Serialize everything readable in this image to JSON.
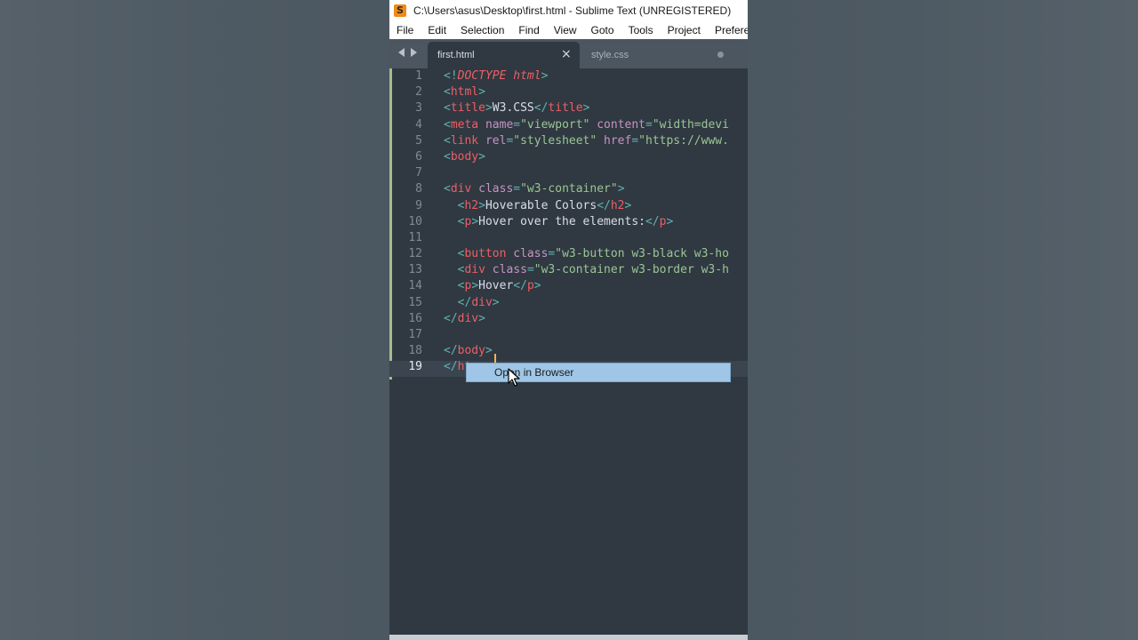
{
  "window": {
    "title": "C:\\Users\\asus\\Desktop\\first.html - Sublime Text (UNREGISTERED)",
    "app_icon_letter": "S"
  },
  "menu": [
    "File",
    "Edit",
    "Selection",
    "Find",
    "View",
    "Goto",
    "Tools",
    "Project",
    "Preferences"
  ],
  "tabs": [
    {
      "label": "first.html",
      "active": true,
      "close": "×"
    },
    {
      "label": "style.css",
      "active": false
    }
  ],
  "editor": {
    "current_line": 19,
    "lines": [
      {
        "n": "1",
        "segs": [
          [
            "p",
            "<!"
          ],
          [
            "d",
            "DOCTYPE"
          ],
          [
            "x",
            " "
          ],
          [
            "d",
            "html"
          ],
          [
            "p",
            ">"
          ]
        ]
      },
      {
        "n": "2",
        "segs": [
          [
            "p",
            "<"
          ],
          [
            "t",
            "html"
          ],
          [
            "p",
            ">"
          ]
        ]
      },
      {
        "n": "3",
        "segs": [
          [
            "p",
            "<"
          ],
          [
            "t",
            "title"
          ],
          [
            "p",
            ">"
          ],
          [
            "x",
            "W3.CSS"
          ],
          [
            "p",
            "</"
          ],
          [
            "t",
            "title"
          ],
          [
            "p",
            ">"
          ]
        ]
      },
      {
        "n": "4",
        "segs": [
          [
            "p",
            "<"
          ],
          [
            "t",
            "meta"
          ],
          [
            "x",
            " "
          ],
          [
            "a",
            "name"
          ],
          [
            "p",
            "="
          ],
          [
            "s",
            "\"viewport\""
          ],
          [
            "x",
            " "
          ],
          [
            "a",
            "content"
          ],
          [
            "p",
            "="
          ],
          [
            "s",
            "\"width=devi"
          ]
        ]
      },
      {
        "n": "5",
        "segs": [
          [
            "p",
            "<"
          ],
          [
            "t",
            "link"
          ],
          [
            "x",
            " "
          ],
          [
            "a",
            "rel"
          ],
          [
            "p",
            "="
          ],
          [
            "s",
            "\"stylesheet\""
          ],
          [
            "x",
            " "
          ],
          [
            "a",
            "href"
          ],
          [
            "p",
            "="
          ],
          [
            "s",
            "\"https://www."
          ]
        ]
      },
      {
        "n": "6",
        "segs": [
          [
            "p",
            "<"
          ],
          [
            "t",
            "body"
          ],
          [
            "p",
            ">"
          ]
        ]
      },
      {
        "n": "7",
        "segs": []
      },
      {
        "n": "8",
        "segs": [
          [
            "p",
            "<"
          ],
          [
            "t",
            "div"
          ],
          [
            "x",
            " "
          ],
          [
            "a",
            "class"
          ],
          [
            "p",
            "="
          ],
          [
            "s",
            "\"w3-container\""
          ],
          [
            "p",
            ">"
          ]
        ]
      },
      {
        "n": "9",
        "segs": [
          [
            "x",
            "  "
          ],
          [
            "p",
            "<"
          ],
          [
            "t",
            "h2"
          ],
          [
            "p",
            ">"
          ],
          [
            "x",
            "Hoverable Colors"
          ],
          [
            "p",
            "</"
          ],
          [
            "t",
            "h2"
          ],
          [
            "p",
            ">"
          ]
        ]
      },
      {
        "n": "10",
        "segs": [
          [
            "x",
            "  "
          ],
          [
            "p",
            "<"
          ],
          [
            "t",
            "p"
          ],
          [
            "p",
            ">"
          ],
          [
            "x",
            "Hover over the elements:"
          ],
          [
            "p",
            "</"
          ],
          [
            "t",
            "p"
          ],
          [
            "p",
            ">"
          ]
        ]
      },
      {
        "n": "11",
        "segs": []
      },
      {
        "n": "12",
        "segs": [
          [
            "x",
            "  "
          ],
          [
            "p",
            "<"
          ],
          [
            "t",
            "button"
          ],
          [
            "x",
            " "
          ],
          [
            "a",
            "class"
          ],
          [
            "p",
            "="
          ],
          [
            "s",
            "\"w3-button w3-black w3-ho"
          ]
        ]
      },
      {
        "n": "13",
        "segs": [
          [
            "x",
            "  "
          ],
          [
            "p",
            "<"
          ],
          [
            "t",
            "div"
          ],
          [
            "x",
            " "
          ],
          [
            "a",
            "class"
          ],
          [
            "p",
            "="
          ],
          [
            "s",
            "\"w3-container w3-border w3-h"
          ]
        ]
      },
      {
        "n": "14",
        "segs": [
          [
            "x",
            "  "
          ],
          [
            "p",
            "<"
          ],
          [
            "t",
            "p"
          ],
          [
            "p",
            ">"
          ],
          [
            "x",
            "Hover"
          ],
          [
            "p",
            "</"
          ],
          [
            "t",
            "p"
          ],
          [
            "p",
            ">"
          ]
        ]
      },
      {
        "n": "15",
        "segs": [
          [
            "x",
            "  "
          ],
          [
            "p",
            "</"
          ],
          [
            "t",
            "div"
          ],
          [
            "p",
            ">"
          ]
        ]
      },
      {
        "n": "16",
        "segs": [
          [
            "p",
            "</"
          ],
          [
            "t",
            "div"
          ],
          [
            "p",
            ">"
          ]
        ]
      },
      {
        "n": "17",
        "segs": []
      },
      {
        "n": "18",
        "segs": [
          [
            "p",
            "</"
          ],
          [
            "t",
            "body"
          ],
          [
            "p",
            ">"
          ]
        ]
      },
      {
        "n": "19",
        "segs": [
          [
            "p",
            "</"
          ],
          [
            "t",
            "ht"
          ]
        ]
      }
    ]
  },
  "context_menu": {
    "item": "Open in Browser"
  },
  "icons": {
    "cursor": "mouse-pointer-icon",
    "tab_modified": "modified-dot-icon"
  }
}
